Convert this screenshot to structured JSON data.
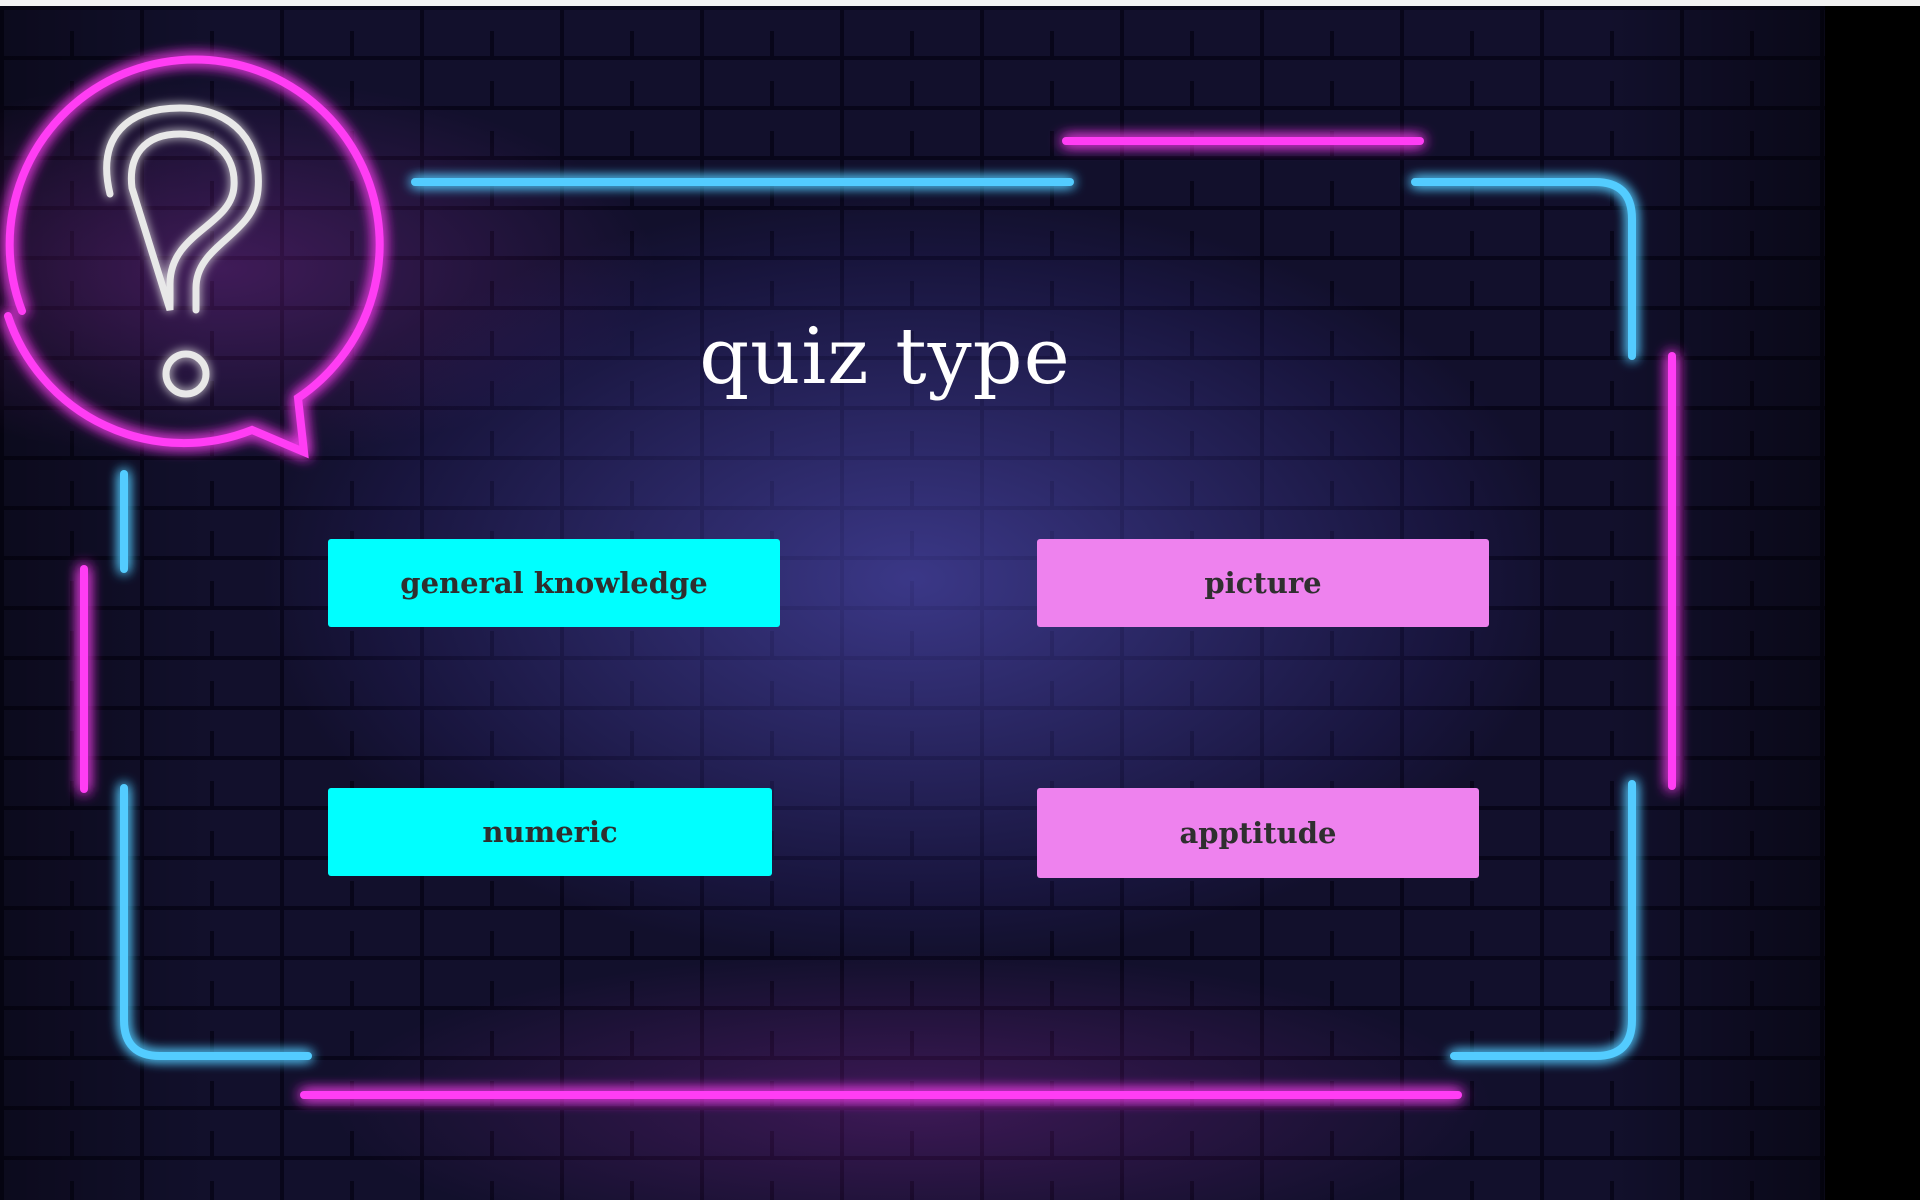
{
  "page": {
    "title": "quiz type"
  },
  "quiz_types": [
    {
      "label": "general knowledge",
      "color": "#00ffff"
    },
    {
      "label": "picture",
      "color": "#ee82ee"
    },
    {
      "label": "numeric",
      "color": "#00ffff"
    },
    {
      "label": "apptitude",
      "color": "#ee82ee"
    }
  ],
  "theme": {
    "neon_blue": "#2fb8ff",
    "neon_pink": "#ff2bf0",
    "button_text_color": "#2f2f2f",
    "title_color": "#ffffff"
  },
  "icons": {
    "question_bubble": "question-mark-speech-bubble-icon"
  }
}
